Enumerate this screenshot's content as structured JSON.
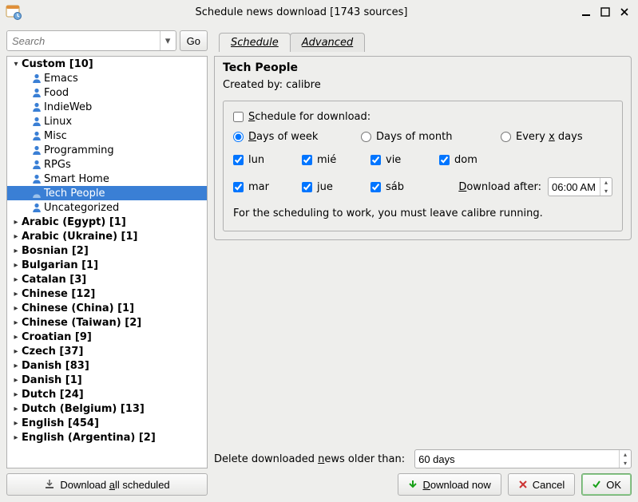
{
  "window": {
    "title": "Schedule news download [1743 sources]"
  },
  "search": {
    "placeholder": "Search",
    "go": "Go"
  },
  "tree": {
    "custom_label": "Custom [10]",
    "custom_items": [
      "Emacs",
      "Food",
      "IndieWeb",
      "Linux",
      "Misc",
      "Programming",
      "RPGs",
      "Smart Home",
      "Tech People",
      "Uncategorized"
    ],
    "selected_child": "Tech People",
    "languages": [
      "Arabic (Egypt) [1]",
      "Arabic (Ukraine) [1]",
      "Bosnian [2]",
      "Bulgarian [1]",
      "Catalan [3]",
      "Chinese [12]",
      "Chinese (China) [1]",
      "Chinese (Taiwan) [2]",
      "Croatian [9]",
      "Czech [37]",
      "Danish [83]",
      "Danish [1]",
      "Dutch [24]",
      "Dutch (Belgium) [13]",
      "English [454]",
      "English (Argentina) [2]"
    ]
  },
  "download_all": "Download all scheduled",
  "tabs": {
    "schedule": "Schedule",
    "advanced": "Advanced"
  },
  "recipe": {
    "title": "Tech People",
    "created_by_label": "Created by: ",
    "created_by_value": "calibre"
  },
  "schedule": {
    "enable_label_pre": "S",
    "enable_label_post": "chedule for download:",
    "mode": {
      "week_pre": "D",
      "week_post": "ays of  week",
      "month": "Days of month",
      "every_pre": "Every ",
      "every_mid": "x",
      "every_post": " days"
    },
    "days": {
      "lun": "lun",
      "mar": "mar",
      "mie": "mié",
      "jue": "jue",
      "vie": "vie",
      "sab": "sáb",
      "dom": "dom"
    },
    "after_label_pre": "D",
    "after_label_post": "ownload after:",
    "after_value": "06:00 AM",
    "note": "For the scheduling to work, you must leave calibre running."
  },
  "delete_row": {
    "label_pre": "Delete downloaded ",
    "label_mid": "n",
    "label_post": "ews older than:",
    "value": "60 days"
  },
  "buttons": {
    "download_now_pre": "D",
    "download_now_post": "ownload now",
    "cancel": "Cancel",
    "ok": "OK"
  }
}
